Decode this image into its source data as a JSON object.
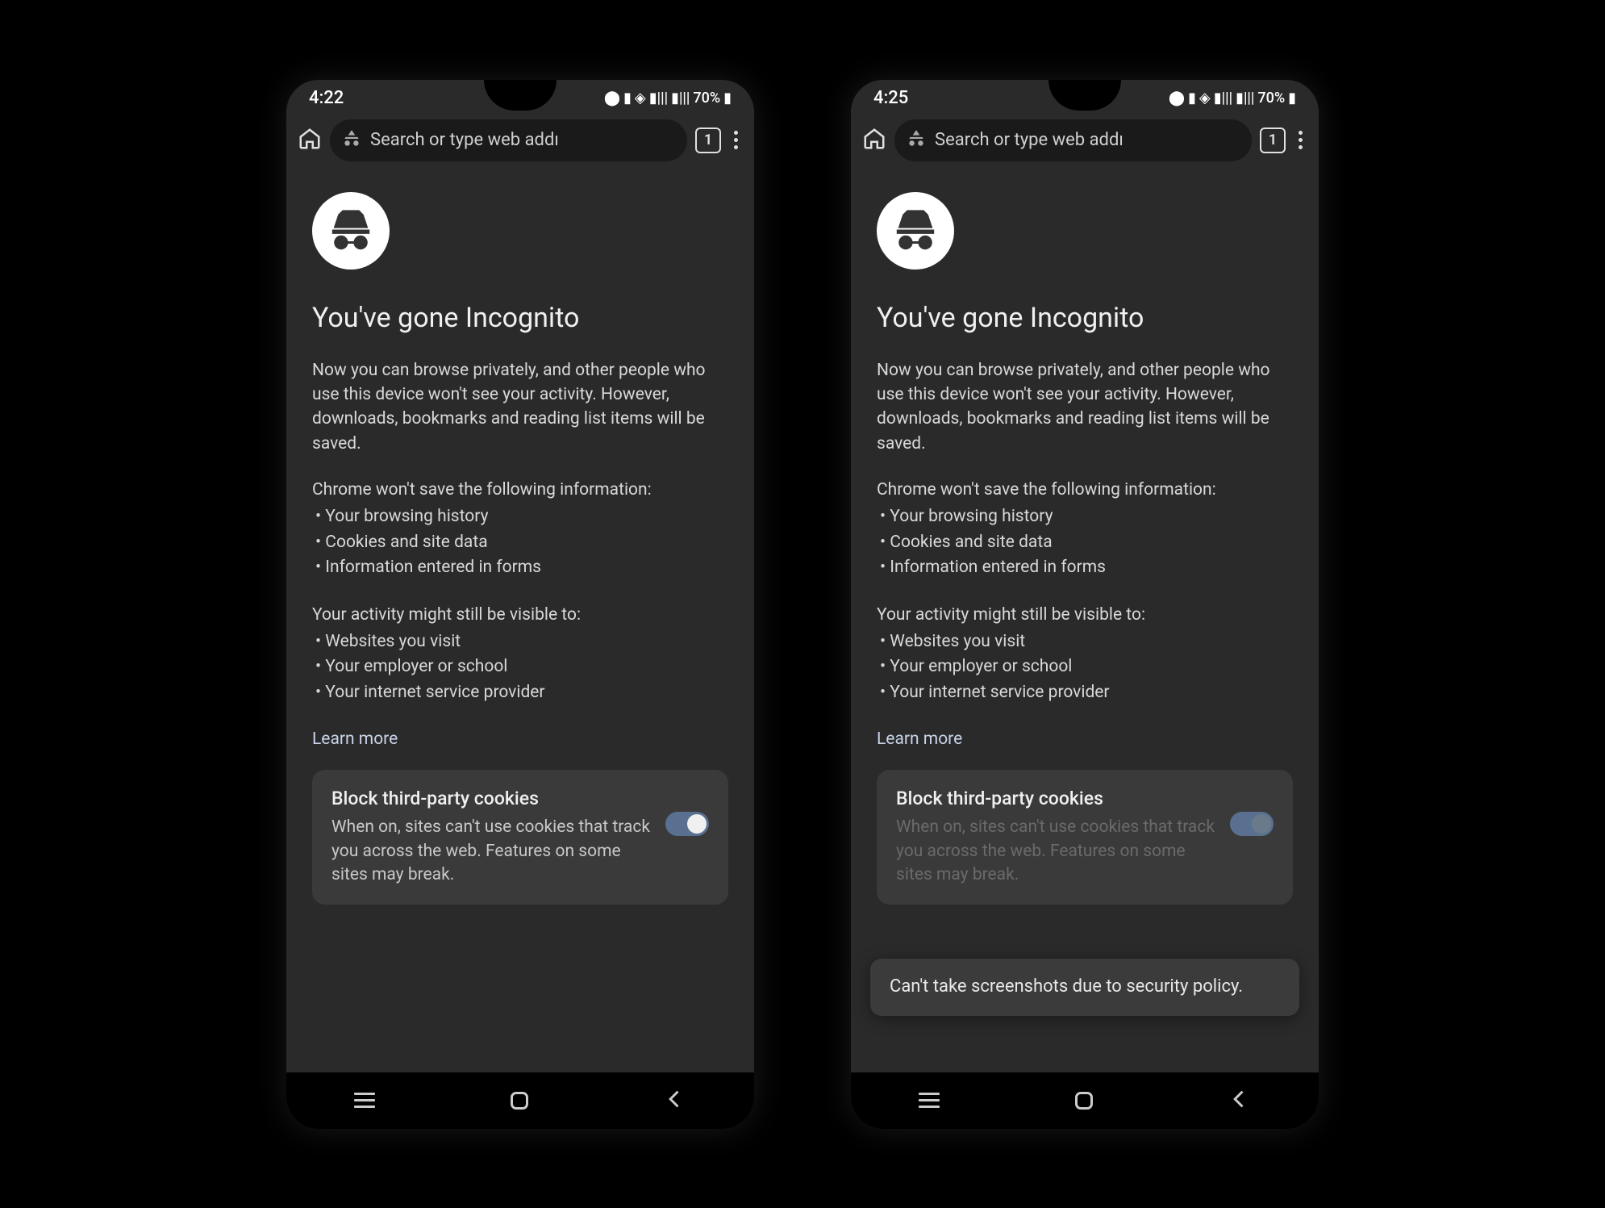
{
  "phones": [
    {
      "status": {
        "time": "4:22",
        "battery": "70%"
      },
      "toolbar": {
        "omnibox_placeholder": "Search or type web addı",
        "tabs_count": "1"
      },
      "page": {
        "title": "You've gone Incognito",
        "intro": "Now you can browse privately, and other people who use this device won't see your activity. However, downloads, bookmarks and reading list items will be saved.",
        "wont_save_heading": "Chrome won't save the following information:",
        "wont_save_items": [
          "Your browsing history",
          "Cookies and site data",
          "Information entered in forms"
        ],
        "visible_heading": "Your activity might still be visible to:",
        "visible_items": [
          "Websites you visit",
          "Your employer or school",
          "Your internet service provider"
        ],
        "learn_more": "Learn more",
        "card": {
          "title": "Block third-party cookies",
          "desc": "When on, sites can't use cookies that track you across the web. Features on some sites may break.",
          "toggle_on": true
        }
      },
      "toast": null
    },
    {
      "status": {
        "time": "4:25",
        "battery": "70%"
      },
      "toolbar": {
        "omnibox_placeholder": "Search or type web addı",
        "tabs_count": "1"
      },
      "page": {
        "title": "You've gone Incognito",
        "intro": "Now you can browse privately, and other people who use this device won't see your activity. However, downloads, bookmarks and reading list items will be saved.",
        "wont_save_heading": "Chrome won't save the following information:",
        "wont_save_items": [
          "Your browsing history",
          "Cookies and site data",
          "Information entered in forms"
        ],
        "visible_heading": "Your activity might still be visible to:",
        "visible_items": [
          "Websites you visit",
          "Your employer or school",
          "Your internet service provider"
        ],
        "learn_more": "Learn more",
        "card": {
          "title": "Block third-party cookies",
          "desc": "When on, sites can't use cookies that track you across the web. Features on some sites may break.",
          "toggle_on": true
        }
      },
      "toast": "Can't take screenshots due to security policy."
    }
  ]
}
